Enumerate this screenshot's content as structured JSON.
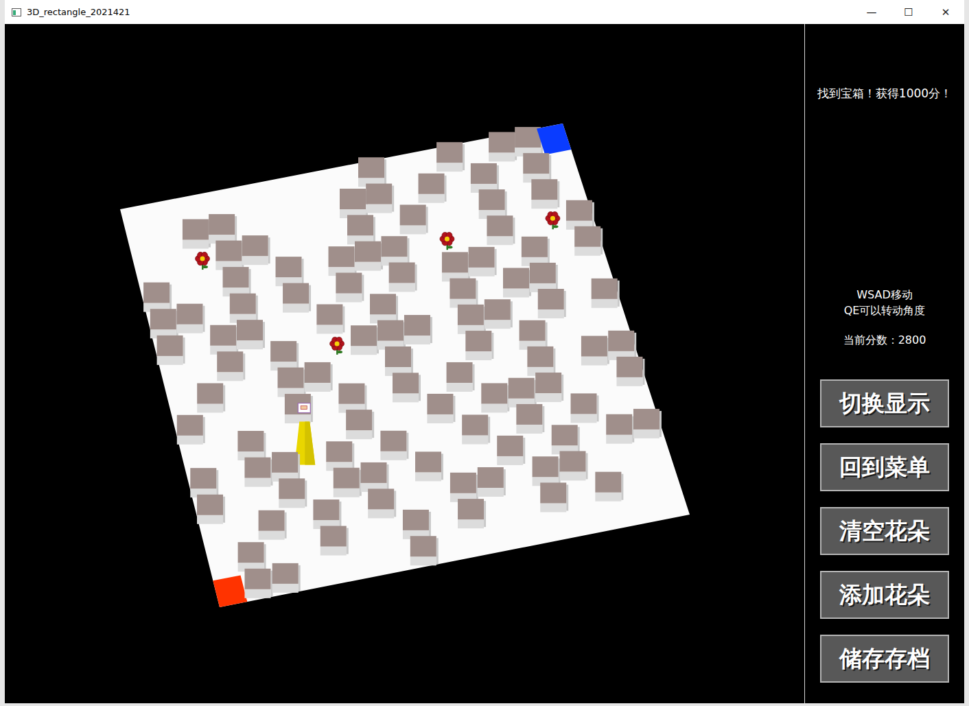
{
  "window": {
    "title": "3D_rectangle_2021421",
    "controls": [
      "—",
      "☐",
      "✕"
    ]
  },
  "maze": {
    "rows": [
      ".........#..#.##E",
      "..##....##.#.#.#.",
      "..F##...#.#..#.#.",
      "#..#.#.###.F.#.F#",
      "##.#.#.#.#.##.#.#",
      "#.##..#.#..#.##..",
      "..#.#.F###.##.#.#",
      ".#..##..#..#.#...",
      "#...#.#.#.#..#.##",
      "..#.P.#..#.###..#",
      "#.##.#.#..#.#.#..",
      "#..#.##.#..#.#.##",
      "..#.#.#..##.##...",
      ".#..#..#.#..#.#..",
      "S##....#........."
    ]
  },
  "panel": {
    "message": "找到宝箱！获得1000分！",
    "instructions": [
      "WSAD移动",
      "QE可以转动角度"
    ],
    "score": {
      "label": "当前分数：",
      "value": "2800"
    }
  },
  "buttons": [
    "切换显示",
    "回到菜单",
    "清空花朵",
    "添加花朵",
    "储存存档"
  ]
}
